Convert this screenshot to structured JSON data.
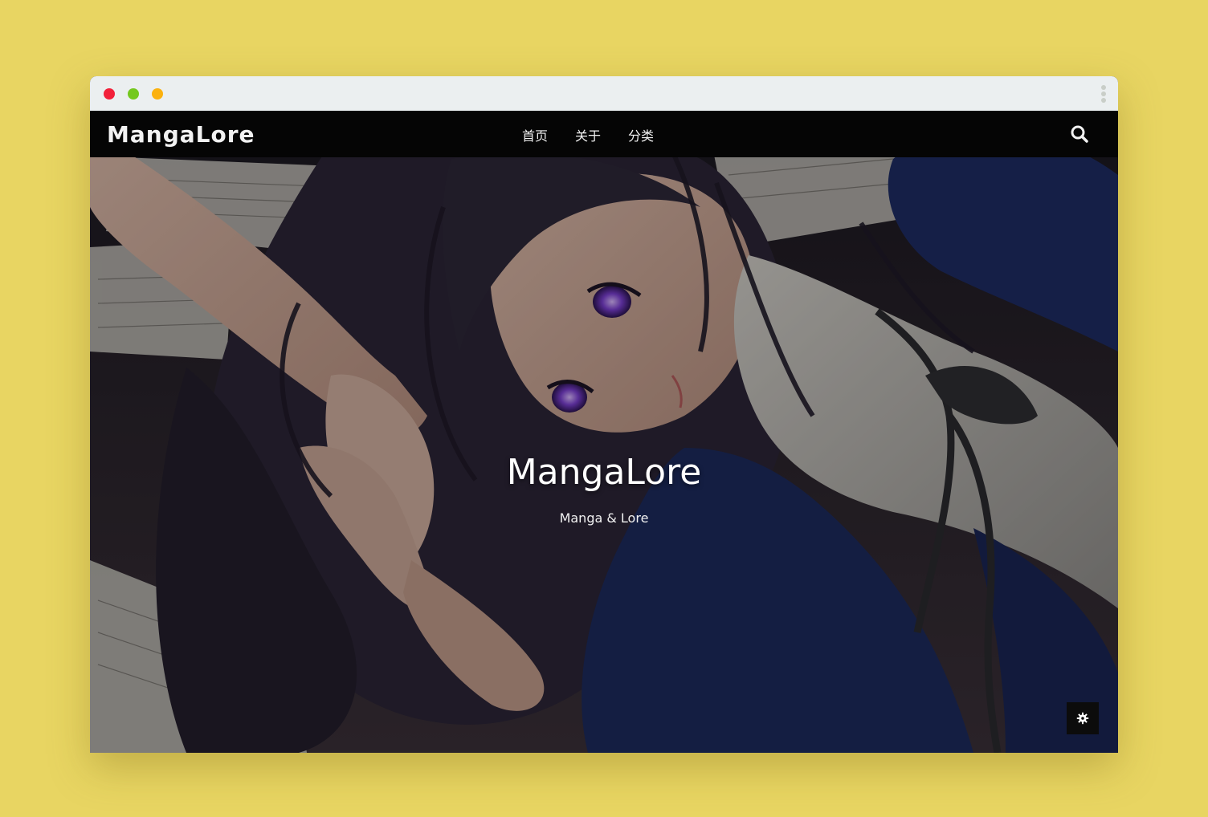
{
  "window": {
    "controls": [
      "close",
      "minimize",
      "maximize"
    ],
    "menu_icon": "kebab-icon"
  },
  "navbar": {
    "brand": "MangaLore",
    "links": [
      {
        "label": "首页"
      },
      {
        "label": "关于"
      },
      {
        "label": "分类"
      }
    ],
    "search_icon": "search-icon"
  },
  "hero": {
    "title": "MangaLore",
    "subtitle": "Manga & Lore",
    "settings_icon": "gear-icon"
  },
  "colors": {
    "page_background": "#e8d562",
    "titlebar": "#ebeff0",
    "navbar": "#050505",
    "close_dot": "#f2213a",
    "minimize_dot": "#74c81e",
    "maximize_dot": "#fbb10e"
  }
}
